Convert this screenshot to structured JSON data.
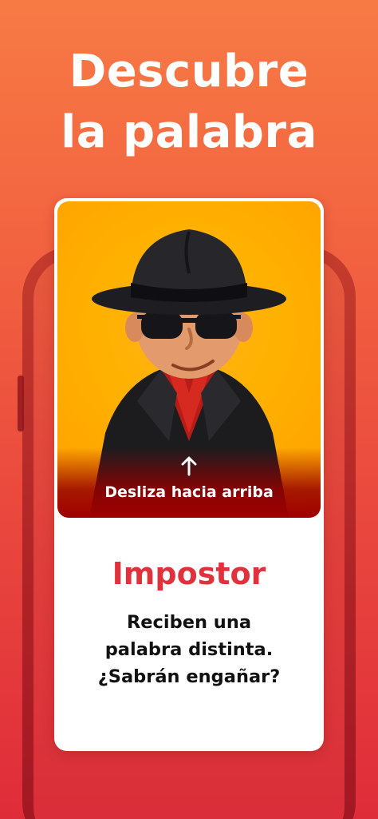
{
  "headline": {
    "line1": "Descubre",
    "line2": "la palabra"
  },
  "card": {
    "swipe_hint": "Desliza hacia arriba",
    "role_title": "Impostor",
    "description": {
      "line1": "Reciben una",
      "line2": "palabra distinta.",
      "line3": "¿Sabrán engañar?"
    }
  },
  "colors": {
    "accent_red": "#e0313c",
    "art_background": "#ffb100",
    "page_gradient_top": "#f77a45",
    "page_gradient_bottom": "#df2c3a"
  },
  "icons": {
    "swipe_icon": "arrow-up-icon"
  }
}
